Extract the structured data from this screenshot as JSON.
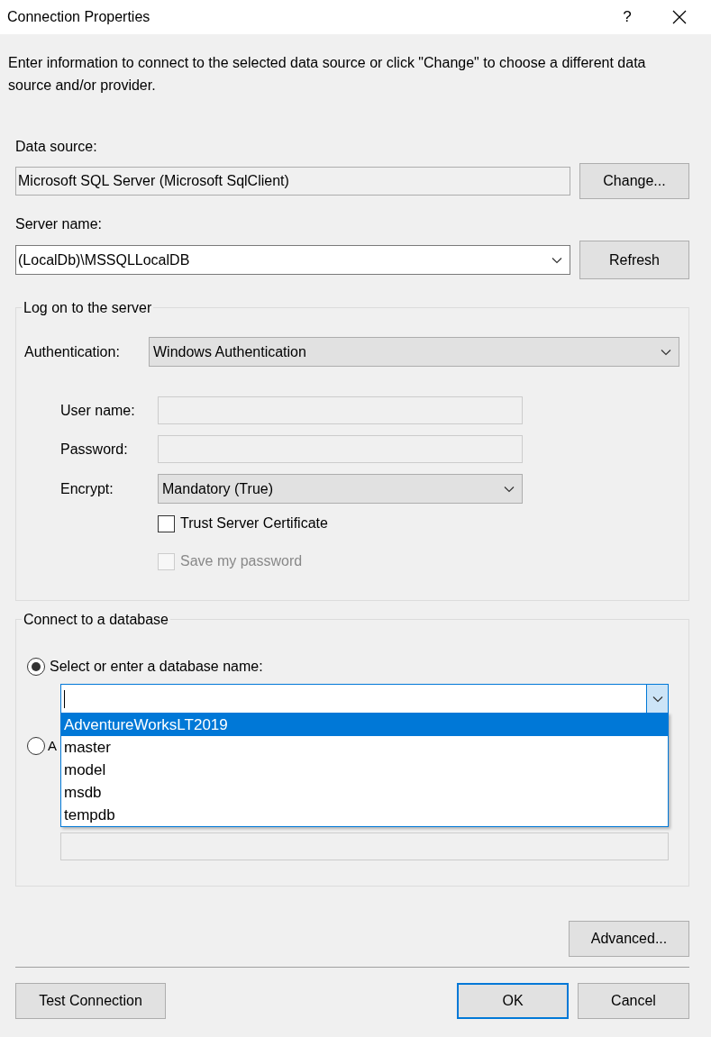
{
  "window": {
    "title": "Connection Properties",
    "help": "?"
  },
  "description": "Enter information to connect to the selected data source or click \"Change\" to choose a different data source and/or provider.",
  "data_source": {
    "label": "Data source:",
    "value": "Microsoft SQL Server (Microsoft SqlClient)",
    "button": "Change..."
  },
  "server_name": {
    "label": "Server name:",
    "value": "(LocalDb)\\MSSQLLocalDB",
    "button": "Refresh"
  },
  "log_on": {
    "title": "Log on to the server",
    "authentication": {
      "label": "Authentication:",
      "value": "Windows Authentication"
    },
    "fields": [
      {
        "label": "User name:",
        "disabled": true
      },
      {
        "label": "Password:",
        "disabled": true
      }
    ],
    "encrypt": {
      "label": "Encrypt:",
      "value": "Mandatory (True)"
    },
    "checkboxes": [
      {
        "label": "Trust Server Certificate",
        "checked": false,
        "disabled": false
      },
      {
        "label": "Save my password",
        "checked": false,
        "disabled": true
      }
    ]
  },
  "connect": {
    "title": "Connect to a database",
    "options": [
      {
        "label": "Select or enter a database name:",
        "selected": true
      },
      {
        "label": "A",
        "selected": false
      }
    ],
    "database_combo": {
      "expanded": true,
      "items": [
        {
          "label": "AdventureWorksLT2019",
          "selected": true
        },
        {
          "label": "master",
          "selected": false
        },
        {
          "label": "model",
          "selected": false
        },
        {
          "label": "msdb",
          "selected": false
        },
        {
          "label": "tempdb",
          "selected": false
        }
      ]
    },
    "file_field": {
      "disabled": true
    }
  },
  "buttons": {
    "advanced": "Advanced...",
    "test": "Test Connection",
    "ok": "OK",
    "cancel": "Cancel"
  }
}
